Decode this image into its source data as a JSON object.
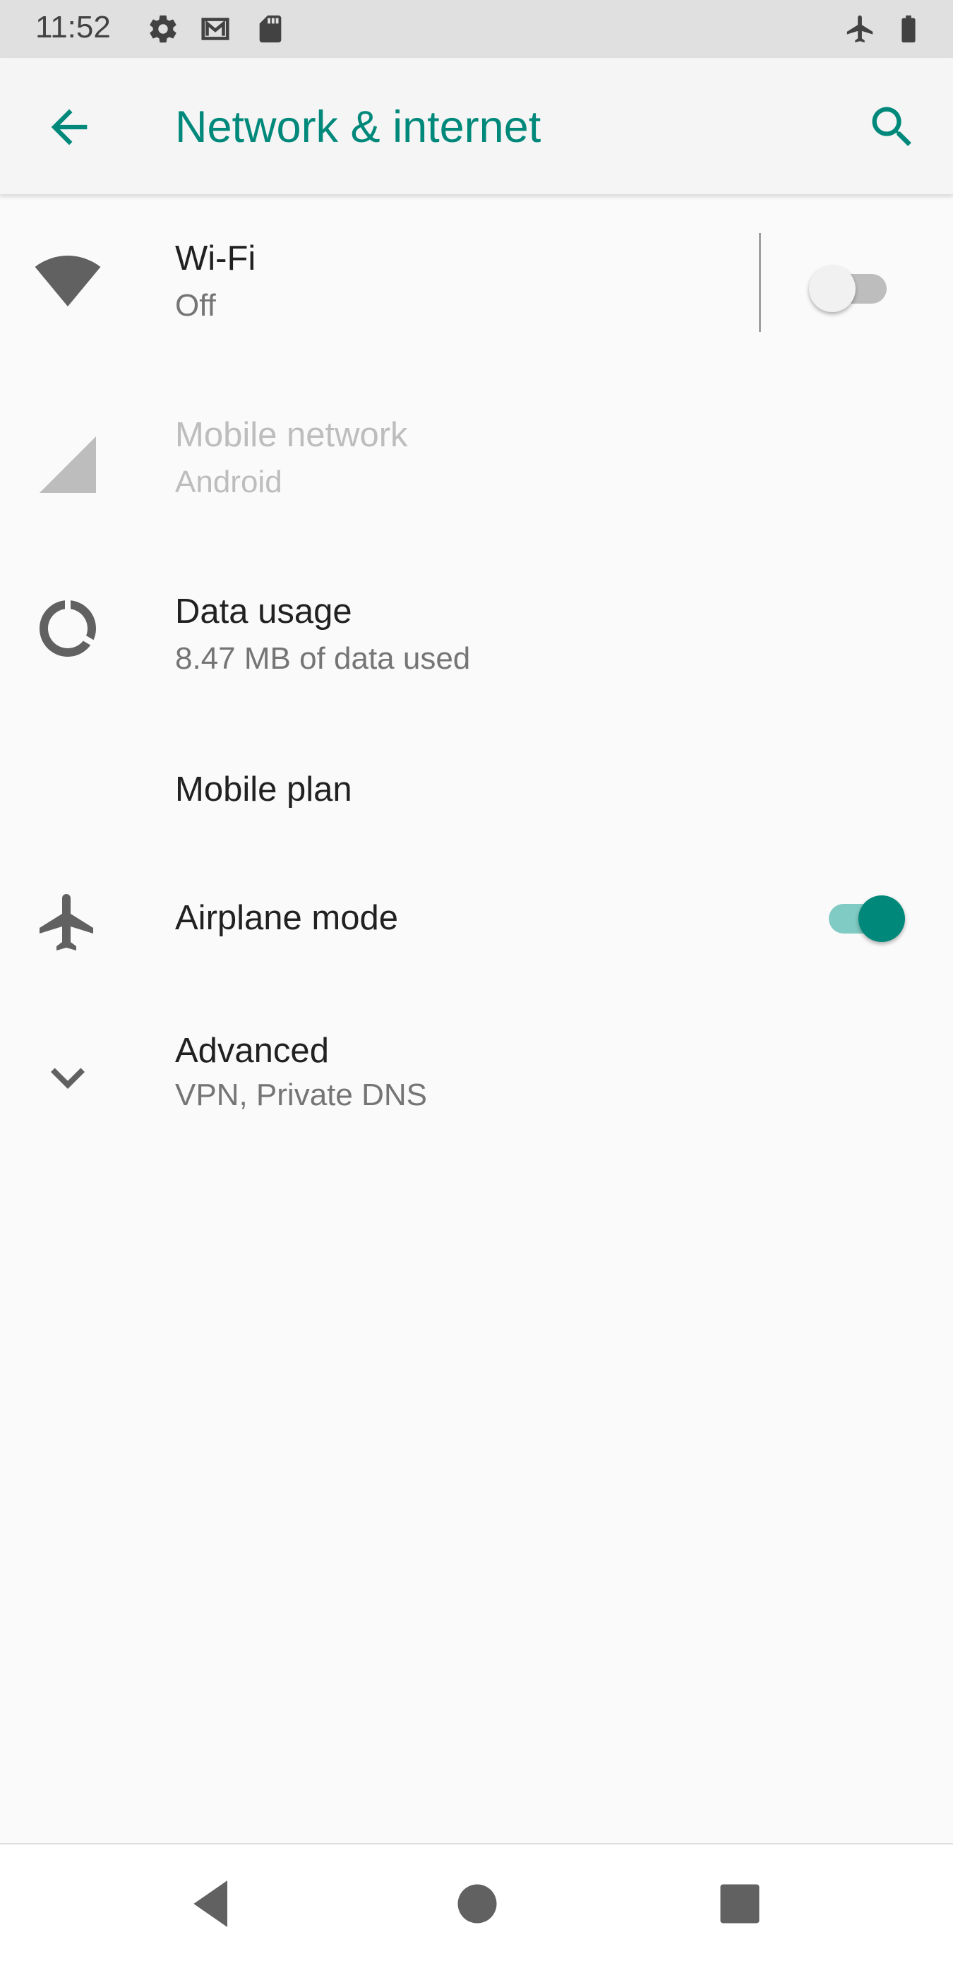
{
  "status_bar": {
    "time": "11:52",
    "left_icons": [
      "gear-icon",
      "gmail-icon",
      "sd-card-icon"
    ],
    "right_icons": [
      "airplane-icon",
      "battery-icon"
    ]
  },
  "app_bar": {
    "title": "Network & internet",
    "back_icon": "arrow-back-icon",
    "search_icon": "search-icon"
  },
  "colors": {
    "accent": "#00897b",
    "accent_light": "#80cbc4",
    "icon_gray": "#616161",
    "disabled": "#bdbdbd"
  },
  "settings": {
    "wifi": {
      "title": "Wi-Fi",
      "summary": "Off",
      "icon": "wifi-icon",
      "enabled": false
    },
    "mobile_network": {
      "title": "Mobile network",
      "summary": "Android",
      "icon": "cell-signal-icon",
      "disabled": true
    },
    "data_usage": {
      "title": "Data usage",
      "summary": "8.47 MB of data used",
      "icon": "data-usage-icon"
    },
    "mobile_plan": {
      "title": "Mobile plan"
    },
    "airplane_mode": {
      "title": "Airplane mode",
      "icon": "airplane-icon",
      "enabled": true
    },
    "advanced": {
      "title": "Advanced",
      "summary": "VPN, Private DNS",
      "icon": "chevron-down-icon"
    }
  },
  "nav_bar": {
    "buttons": [
      "back-triangle-icon",
      "home-circle-icon",
      "recents-square-icon"
    ]
  }
}
